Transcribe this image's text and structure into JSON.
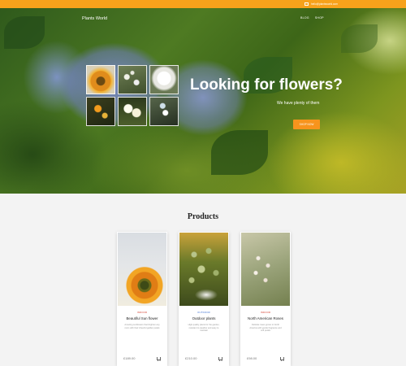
{
  "topbar": {
    "contact": "hello@plantsworld.com"
  },
  "nav": {
    "brand": "Plants World",
    "links": [
      "BLOG",
      "SHOP"
    ]
  },
  "hero": {
    "headline": "Looking for flowers?",
    "subline": "We have plenty of them",
    "cta": "SHOP NOW"
  },
  "products": {
    "title": "Products",
    "items": [
      {
        "tag": "INDOOR",
        "name": "Beautiful Sun flower",
        "desc": "Amazing sunflowers that brighten any room with their cheerful golden petals",
        "price": "£189.00",
        "tag_color": "#d23a2a"
      },
      {
        "tag": "OUTDOOR",
        "name": "Outdoor plants",
        "desc": "High quality plants for the garden, resistant to weather and easy to maintain",
        "price": "£210.00",
        "tag_color": "#3b6ed0"
      },
      {
        "tag": "INDOOR",
        "name": "North American Roses",
        "desc": "Delicate roses grown in North America with gentle fragrance and soft petals",
        "price": "£98.00",
        "tag_color": "#d23a2a"
      }
    ]
  },
  "colors": {
    "accent": "#f7941d",
    "topbar": "#f7a21b"
  }
}
